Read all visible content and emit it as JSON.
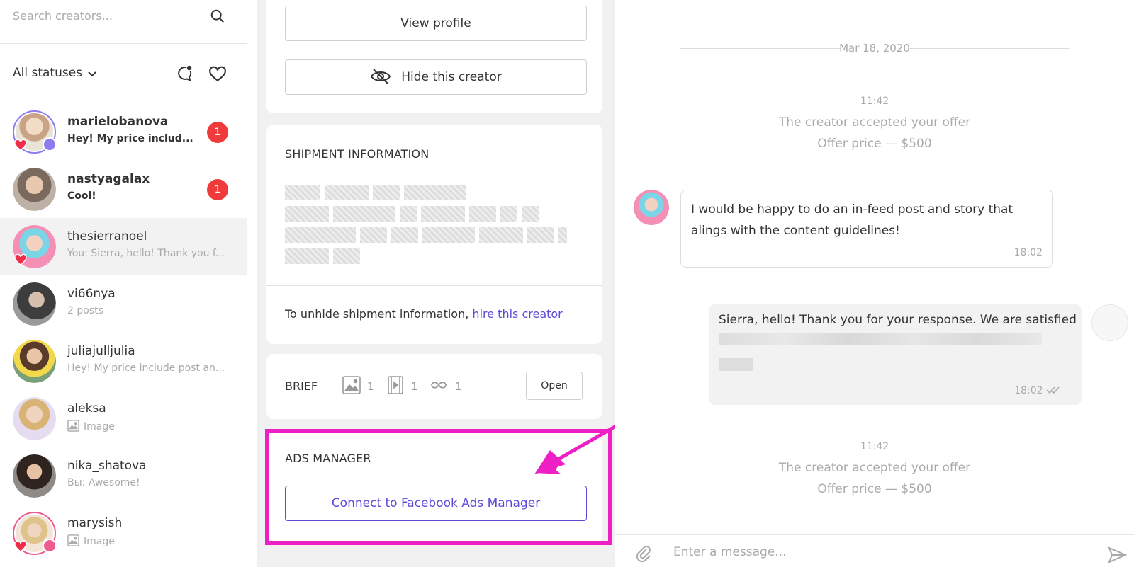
{
  "search": {
    "placeholder": "Search creators..."
  },
  "filter": {
    "status_label": "All statuses"
  },
  "chats": [
    {
      "name": "marielobanova",
      "preview": "Hey! My price includ...",
      "unread": "1",
      "bold": true
    },
    {
      "name": "nastyagalax",
      "preview": "Cool!",
      "unread": "1",
      "bold": true
    },
    {
      "name": "thesierranoel",
      "preview": "You: Sierra, hello! Thank you f...",
      "active": true
    },
    {
      "name": "vi66nya",
      "preview": "2 posts"
    },
    {
      "name": "juliajulljulia",
      "preview": "Hey! My price include post an..."
    },
    {
      "name": "aleksa",
      "preview": "Image"
    },
    {
      "name": "nika_shatova",
      "preview": "Вы: Awesome!"
    },
    {
      "name": "marysish",
      "preview": "Image"
    }
  ],
  "profile": {
    "view_profile": "View profile",
    "hide_creator": "Hide this creator"
  },
  "shipment": {
    "title": "SHIPMENT INFORMATION",
    "unhide_text": "To unhide shipment information,",
    "unhide_link": "hire this creator"
  },
  "brief": {
    "label": "BRIEF",
    "image_count": "1",
    "video_count": "1",
    "story_count": "1",
    "open_label": "Open"
  },
  "ads": {
    "title": "ADS MANAGER",
    "connect_label": "Connect to Facebook Ads Manager"
  },
  "conversation": {
    "date": "Mar 18, 2020",
    "system1": {
      "time": "11:42",
      "line1": "The creator accepted your offer",
      "line2": "Offer price — $500"
    },
    "incoming": {
      "text": "I would be happy to do an in-feed post and story that alings with the content guidelines!",
      "time": "18:02"
    },
    "outgoing": {
      "text": "Sierra, hello! Thank you for your response. We are satisfied",
      "time": "18:02"
    },
    "system2": {
      "time": "11:42",
      "line1": "The creator accepted your offer",
      "line2": "Offer price — $500"
    },
    "composer_placeholder": "Enter a message..."
  },
  "colors": {
    "accent": "#5b4cd8",
    "unread": "#ef3b3b",
    "highlight": "#ee1fc4"
  }
}
